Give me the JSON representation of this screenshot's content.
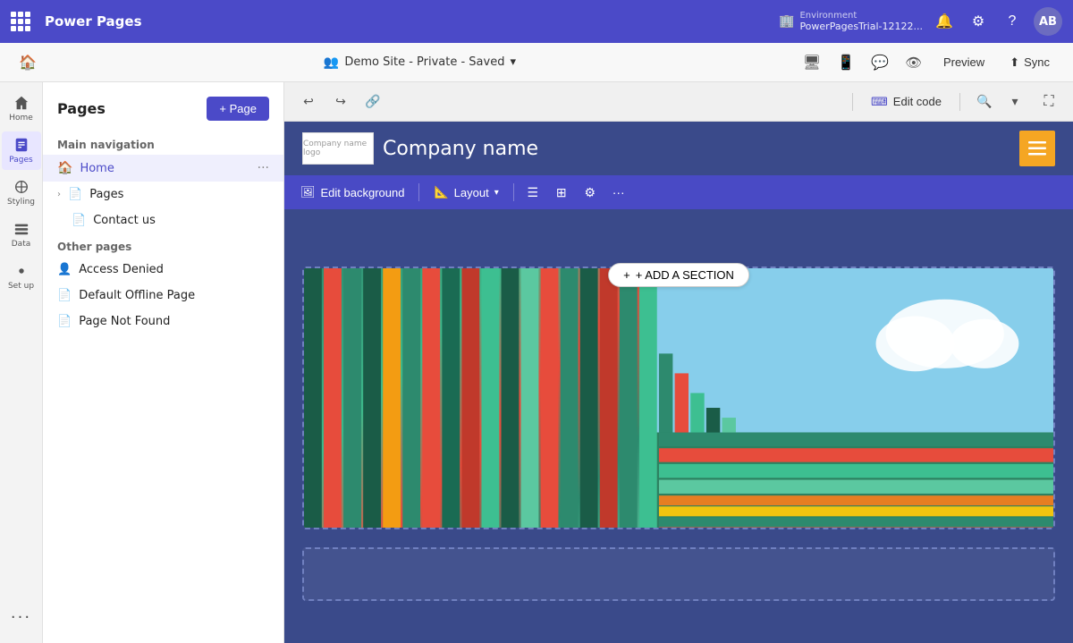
{
  "topbar": {
    "waffle_label": "⠿",
    "app_name": "Power Pages",
    "env_label": "Environment",
    "env_name": "PowerPagesTrial-12122...",
    "avatar_initials": "AB"
  },
  "subbar": {
    "site_icon": "👤",
    "site_name": "Demo Site - Private - Saved",
    "caret": "▾",
    "preview_label": "Preview",
    "sync_label": "Sync"
  },
  "sidebar_icons": [
    {
      "id": "home",
      "label": "Home",
      "active": false
    },
    {
      "id": "pages",
      "label": "Pages",
      "active": true
    },
    {
      "id": "styling",
      "label": "Styling",
      "active": false
    },
    {
      "id": "data",
      "label": "Data",
      "active": false
    },
    {
      "id": "setup",
      "label": "Set up",
      "active": false
    }
  ],
  "pages_panel": {
    "title": "Pages",
    "add_page_label": "+ Page",
    "main_nav_label": "Main navigation",
    "pages_items": [
      {
        "id": "home",
        "label": "Home",
        "active": true,
        "type": "home"
      },
      {
        "id": "pages",
        "label": "Pages",
        "active": false,
        "type": "expandable"
      },
      {
        "id": "contact-us",
        "label": "Contact us",
        "active": false,
        "type": "page"
      }
    ],
    "other_pages_label": "Other pages",
    "other_items": [
      {
        "id": "access-denied",
        "label": "Access Denied",
        "type": "user"
      },
      {
        "id": "default-offline",
        "label": "Default Offline Page",
        "type": "page"
      },
      {
        "id": "page-not-found",
        "label": "Page Not Found",
        "type": "page"
      }
    ]
  },
  "toolbar": {
    "undo_label": "↩",
    "redo_label": "↪",
    "link_label": "🔗",
    "edit_code_label": "Edit code",
    "zoom_label": "🔍",
    "expand_label": "⛶"
  },
  "section_toolbar": {
    "edit_bg_label": "Edit background",
    "layout_label": "Layout",
    "add_section_label": "+ ADD A SECTION"
  },
  "site": {
    "logo_alt": "Company name logo",
    "company_name": "Company name"
  }
}
